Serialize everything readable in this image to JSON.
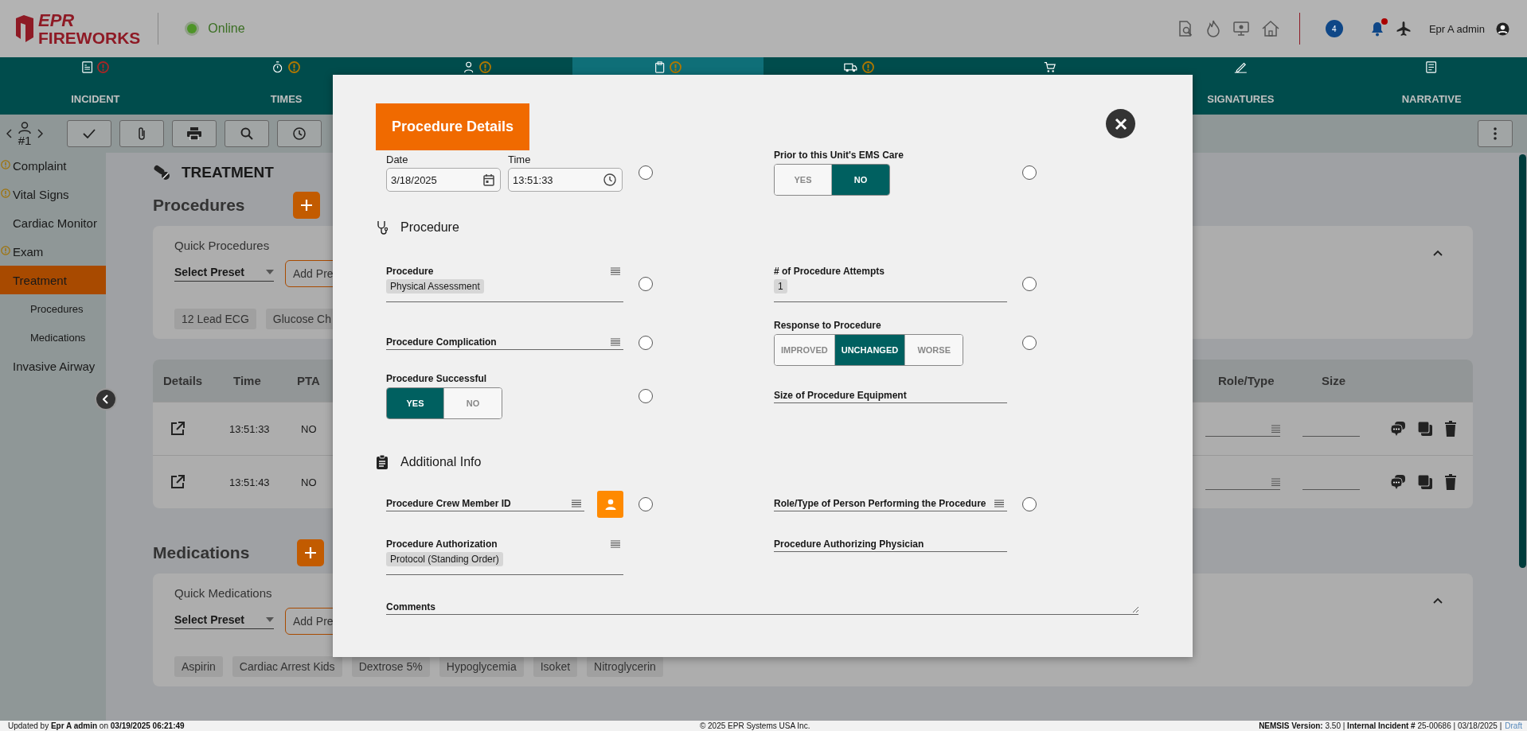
{
  "header": {
    "logo_top": "EPR",
    "logo_bottom": "FIREWORKS",
    "status": "Online",
    "message_count": "4",
    "bell_alert": true,
    "user": "Epr A admin"
  },
  "nav_tabs": [
    {
      "label": "INCIDENT",
      "selected": false,
      "alert": true,
      "color": "#a52727"
    },
    {
      "label": "TIMES",
      "selected": false,
      "alert": true,
      "color": "#b07800"
    },
    {
      "selected": false,
      "alert": true,
      "color": "#b07800"
    },
    {
      "selected": true,
      "alert": true,
      "color": "#b07800"
    },
    {
      "selected": false,
      "alert": true,
      "color": "#b07800"
    },
    {
      "selected": false,
      "alert": false
    },
    {
      "label": "SIGNATURES",
      "selected": false,
      "alert": false
    },
    {
      "label": "NARRATIVE",
      "selected": false,
      "alert": false
    }
  ],
  "toolbar": {
    "patient": "#1"
  },
  "sidebar": {
    "items": [
      {
        "label": "Complaint",
        "alert": true,
        "selected": false
      },
      {
        "label": "Vital Signs",
        "alert": true,
        "selected": false
      },
      {
        "label": "Cardiac Monitor",
        "alert": false,
        "selected": false
      },
      {
        "label": "Exam",
        "alert": true,
        "selected": false
      },
      {
        "label": "Treatment",
        "alert": false,
        "selected": true,
        "children": [
          {
            "label": "Procedures",
            "selected": false
          },
          {
            "label": "Medications",
            "selected": false
          }
        ]
      },
      {
        "label": "Invasive Airway",
        "alert": false,
        "selected": false
      }
    ]
  },
  "main": {
    "title": "TREATMENT",
    "procedures": {
      "heading": "Procedures",
      "quick": {
        "title": "Quick Procedures",
        "preset": "Select Preset",
        "add": "Add Pre",
        "expanded": true,
        "chips": [
          "12 Lead ECG",
          "Glucose Ch"
        ]
      },
      "table": {
        "columns": [
          "Details",
          "Time",
          "PTA"
        ],
        "columns_right": [
          "Role/Type",
          "Size"
        ],
        "rows": [
          {
            "time": "13:51:33",
            "pta": "NO"
          },
          {
            "time": "13:51:43",
            "pta": "NO"
          }
        ]
      }
    },
    "medications": {
      "heading": "Medications",
      "quick": {
        "title": "Quick Medications",
        "preset": "Select Preset",
        "add": "Add Pre",
        "expanded": true,
        "chips": [
          "Aspirin",
          "Cardiac Arrest Kids",
          "Dextrose 5%",
          "Hypoglycemia",
          "Isoket",
          "Nitroglycerin"
        ]
      }
    }
  },
  "modal": {
    "title": "Procedure Details",
    "rows": [
      {
        "kind": "pair",
        "cells": [
          {
            "kind": "datetime",
            "date_label": "Date",
            "date": "3/18/2025",
            "time_label": "Time",
            "time": "13:51:33",
            "checked": false
          },
          {
            "kind": "toggle",
            "label": "Prior to this Unit's EMS Care",
            "options": [
              {
                "label": "YES",
                "selected": false
              },
              {
                "label": "NO",
                "selected": true
              }
            ],
            "checked": false
          }
        ]
      },
      {
        "kind": "heading",
        "label": "Procedure"
      },
      {
        "kind": "pair",
        "cells": [
          {
            "kind": "select",
            "label": "Procedure",
            "value": "Physical Assessment",
            "checked": false
          },
          {
            "kind": "text",
            "label": "# of Procedure Attempts",
            "value": "1",
            "checked": false
          }
        ]
      },
      {
        "kind": "pair",
        "cells": [
          {
            "kind": "select",
            "label": "Procedure Complication",
            "checked": false
          },
          {
            "kind": "toggle",
            "label": "Response to Procedure",
            "options": [
              {
                "label": "IMPROVED",
                "selected": false
              },
              {
                "label": "UNCHANGED",
                "selected": true
              },
              {
                "label": "WORSE",
                "selected": false
              }
            ],
            "checked": false
          }
        ]
      },
      {
        "kind": "pair",
        "cells": [
          {
            "kind": "toggle",
            "label": "Procedure Successful",
            "options": [
              {
                "label": "YES",
                "selected": true
              },
              {
                "label": "NO",
                "selected": false
              }
            ],
            "checked": false
          },
          {
            "kind": "text",
            "label": "Size of Procedure Equipment"
          }
        ]
      },
      {
        "kind": "heading",
        "label": "Additional Info"
      },
      {
        "kind": "pair",
        "cells": [
          {
            "kind": "crew",
            "label": "Procedure Crew Member ID",
            "checked": false
          },
          {
            "kind": "select",
            "label": "Role/Type of Person Performing the Procedure",
            "checked": false
          }
        ]
      },
      {
        "kind": "pair",
        "cells": [
          {
            "kind": "select",
            "label": "Procedure Authorization",
            "value": "Protocol (Standing Order)"
          },
          {
            "kind": "text",
            "label": "Procedure Authorizing Physician"
          }
        ]
      },
      {
        "kind": "comments",
        "label": "Comments"
      }
    ]
  },
  "status_bar": {
    "left": "Updated by **Epr A admin** on **03/19/2025 06:21:49**",
    "center": "© 2025 EPR Systems USA Inc.",
    "right": "**NEMSIS Version:** 3.50 | **Internal Incident #** 25-00686 | 03/18/2025 |",
    "link": "Draft"
  }
}
